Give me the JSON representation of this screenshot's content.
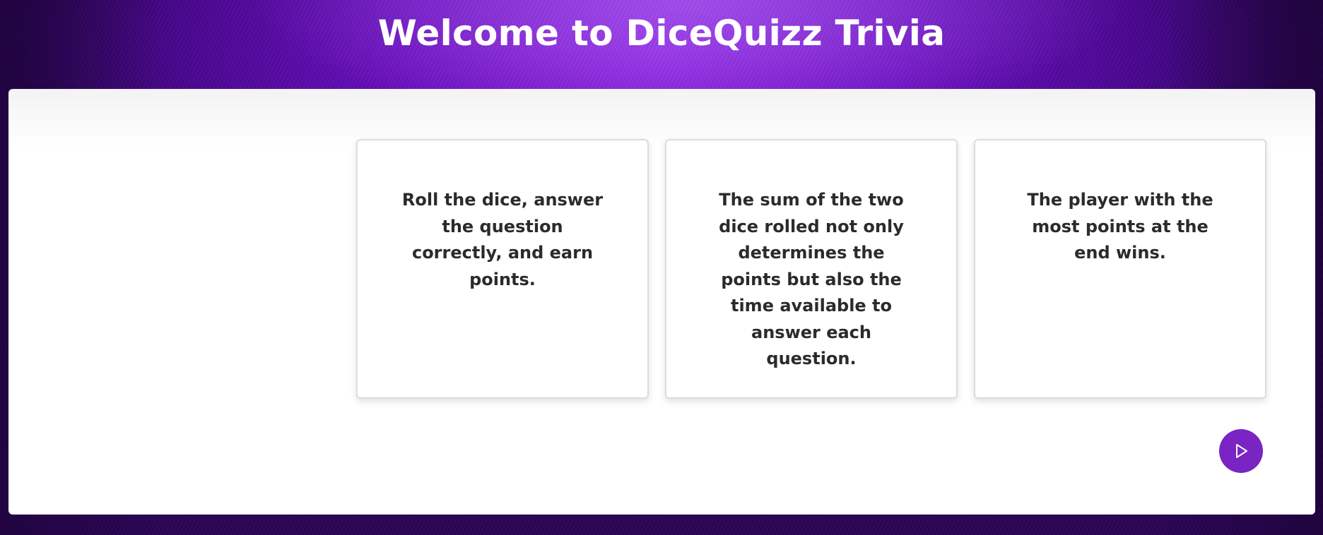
{
  "header": {
    "title": "Welcome to DiceQuizz Trivia"
  },
  "cards": [
    {
      "text": "Roll the dice, answer the question correctly, and earn points."
    },
    {
      "text": "The sum of the two dice rolled not only determines the points but also the time available to answer each question."
    },
    {
      "text": "The player with the most points at the end wins."
    }
  ],
  "dice": {
    "icon": "dice-icon"
  },
  "play_button": {
    "icon": "play-icon"
  },
  "colors": {
    "background": "#6a0fbf",
    "accent": "#7a24c4",
    "card_text": "#2b2b2b"
  }
}
